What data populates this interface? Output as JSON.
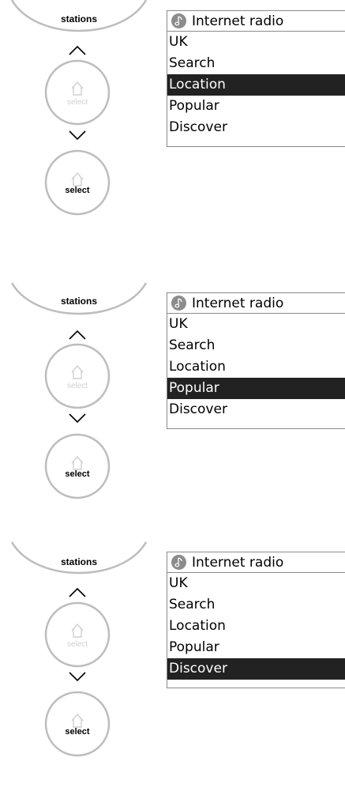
{
  "colors": {
    "outline": "#bdbdbd",
    "highlight": "#222222",
    "faded_text": "#d0d0d0",
    "icon_grey": "#8c8c8c"
  },
  "panels": [
    {
      "controls": {
        "stations_label": "stations",
        "up_arrow": "up-chevron-icon",
        "faded_select_label": "select",
        "down_arrow": "down-chevron-icon",
        "select_label": "select"
      },
      "screen": {
        "icon": "music-note-icon",
        "title": "Internet radio",
        "items": [
          "UK",
          "Search",
          "Location",
          "Popular",
          "Discover"
        ],
        "selected": "Location"
      }
    },
    {
      "controls": {
        "stations_label": "stations",
        "up_arrow": "up-chevron-icon",
        "faded_select_label": "select",
        "down_arrow": "down-chevron-icon",
        "select_label": "select"
      },
      "screen": {
        "icon": "music-note-icon",
        "title": "Internet radio",
        "items": [
          "UK",
          "Search",
          "Location",
          "Popular",
          "Discover"
        ],
        "selected": "Popular"
      }
    },
    {
      "controls": {
        "stations_label": "stations",
        "up_arrow": "up-chevron-icon",
        "faded_select_label": "select",
        "down_arrow": "down-chevron-icon",
        "select_label": "select"
      },
      "screen": {
        "icon": "music-note-icon",
        "title": "Internet radio",
        "items": [
          "UK",
          "Search",
          "Location",
          "Popular",
          "Discover"
        ],
        "selected": "Discover"
      }
    }
  ]
}
